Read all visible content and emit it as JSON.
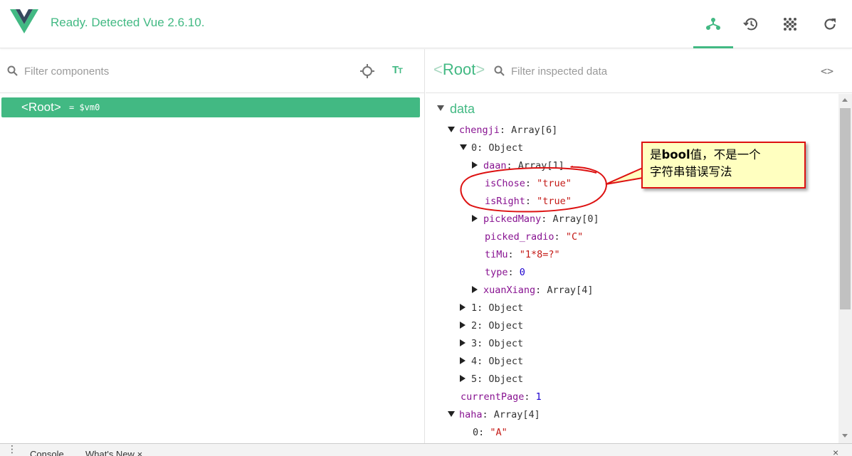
{
  "header": {
    "status": "Ready. Detected Vue 2.6.10.",
    "buttons": [
      {
        "name": "components-tab",
        "icon": "component-tree-icon",
        "active": true
      },
      {
        "name": "timeline-tab",
        "icon": "history-icon",
        "active": false
      },
      {
        "name": "performance-tab",
        "icon": "dots-grid-icon",
        "active": false
      },
      {
        "name": "refresh-button",
        "icon": "refresh-icon",
        "active": false
      }
    ],
    "accent": "#42b983"
  },
  "left": {
    "filter_placeholder": "Filter components",
    "tree": [
      {
        "tag": "<Root>",
        "suffix": "= $vm0",
        "selected": true
      }
    ]
  },
  "right": {
    "open": "<",
    "title": "Root",
    "close": ">",
    "filter_placeholder": "Filter inspected data",
    "code_icon": "<>",
    "section": "data",
    "rows": [
      {
        "indent": 0,
        "toggle": "down",
        "key": "chengji",
        "type": "Array[6]"
      },
      {
        "indent": 1,
        "toggle": "down",
        "key": "0",
        "type": "Object",
        "plain_key": true
      },
      {
        "indent": 2,
        "toggle": "right",
        "key": "daan",
        "type": "Array[1]"
      },
      {
        "indent": 2,
        "toggle": "none",
        "key": "isChose",
        "value": "\"true\"",
        "vtype": "str"
      },
      {
        "indent": 2,
        "toggle": "none",
        "key": "isRight",
        "value": "\"true\"",
        "vtype": "str"
      },
      {
        "indent": 2,
        "toggle": "right",
        "key": "pickedMany",
        "type": "Array[0]"
      },
      {
        "indent": 2,
        "toggle": "none",
        "key": "picked_radio",
        "value": "\"C\"",
        "vtype": "str"
      },
      {
        "indent": 2,
        "toggle": "none",
        "key": "tiMu",
        "value": "\"1*8=?\"",
        "vtype": "str"
      },
      {
        "indent": 2,
        "toggle": "none",
        "key": "type",
        "value": "0",
        "vtype": "num"
      },
      {
        "indent": 2,
        "toggle": "right",
        "key": "xuanXiang",
        "type": "Array[4]"
      },
      {
        "indent": 1,
        "toggle": "right",
        "key": "1",
        "type": "Object",
        "plain_key": true
      },
      {
        "indent": 1,
        "toggle": "right",
        "key": "2",
        "type": "Object",
        "plain_key": true
      },
      {
        "indent": 1,
        "toggle": "right",
        "key": "3",
        "type": "Object",
        "plain_key": true
      },
      {
        "indent": 1,
        "toggle": "right",
        "key": "4",
        "type": "Object",
        "plain_key": true
      },
      {
        "indent": 1,
        "toggle": "right",
        "key": "5",
        "type": "Object",
        "plain_key": true
      },
      {
        "indent": 0,
        "toggle": "none",
        "key": "currentPage",
        "value": "1",
        "vtype": "num"
      },
      {
        "indent": 0,
        "toggle": "down",
        "key": "haha",
        "type": "Array[4]"
      },
      {
        "indent": 1,
        "toggle": "none",
        "key": "0",
        "value": "\"A\"",
        "vtype": "str",
        "plain_key": true
      }
    ]
  },
  "annotation": {
    "line1_pre": "是",
    "line1_bold": "bool",
    "line1_post": "值，不是一个",
    "line2": "字符串错误写法",
    "border_color": "#dd1111",
    "fill_color": "#ffffc0"
  },
  "drawer": {
    "tabs": [
      "Console",
      "What's New"
    ],
    "close_icon": "×"
  }
}
